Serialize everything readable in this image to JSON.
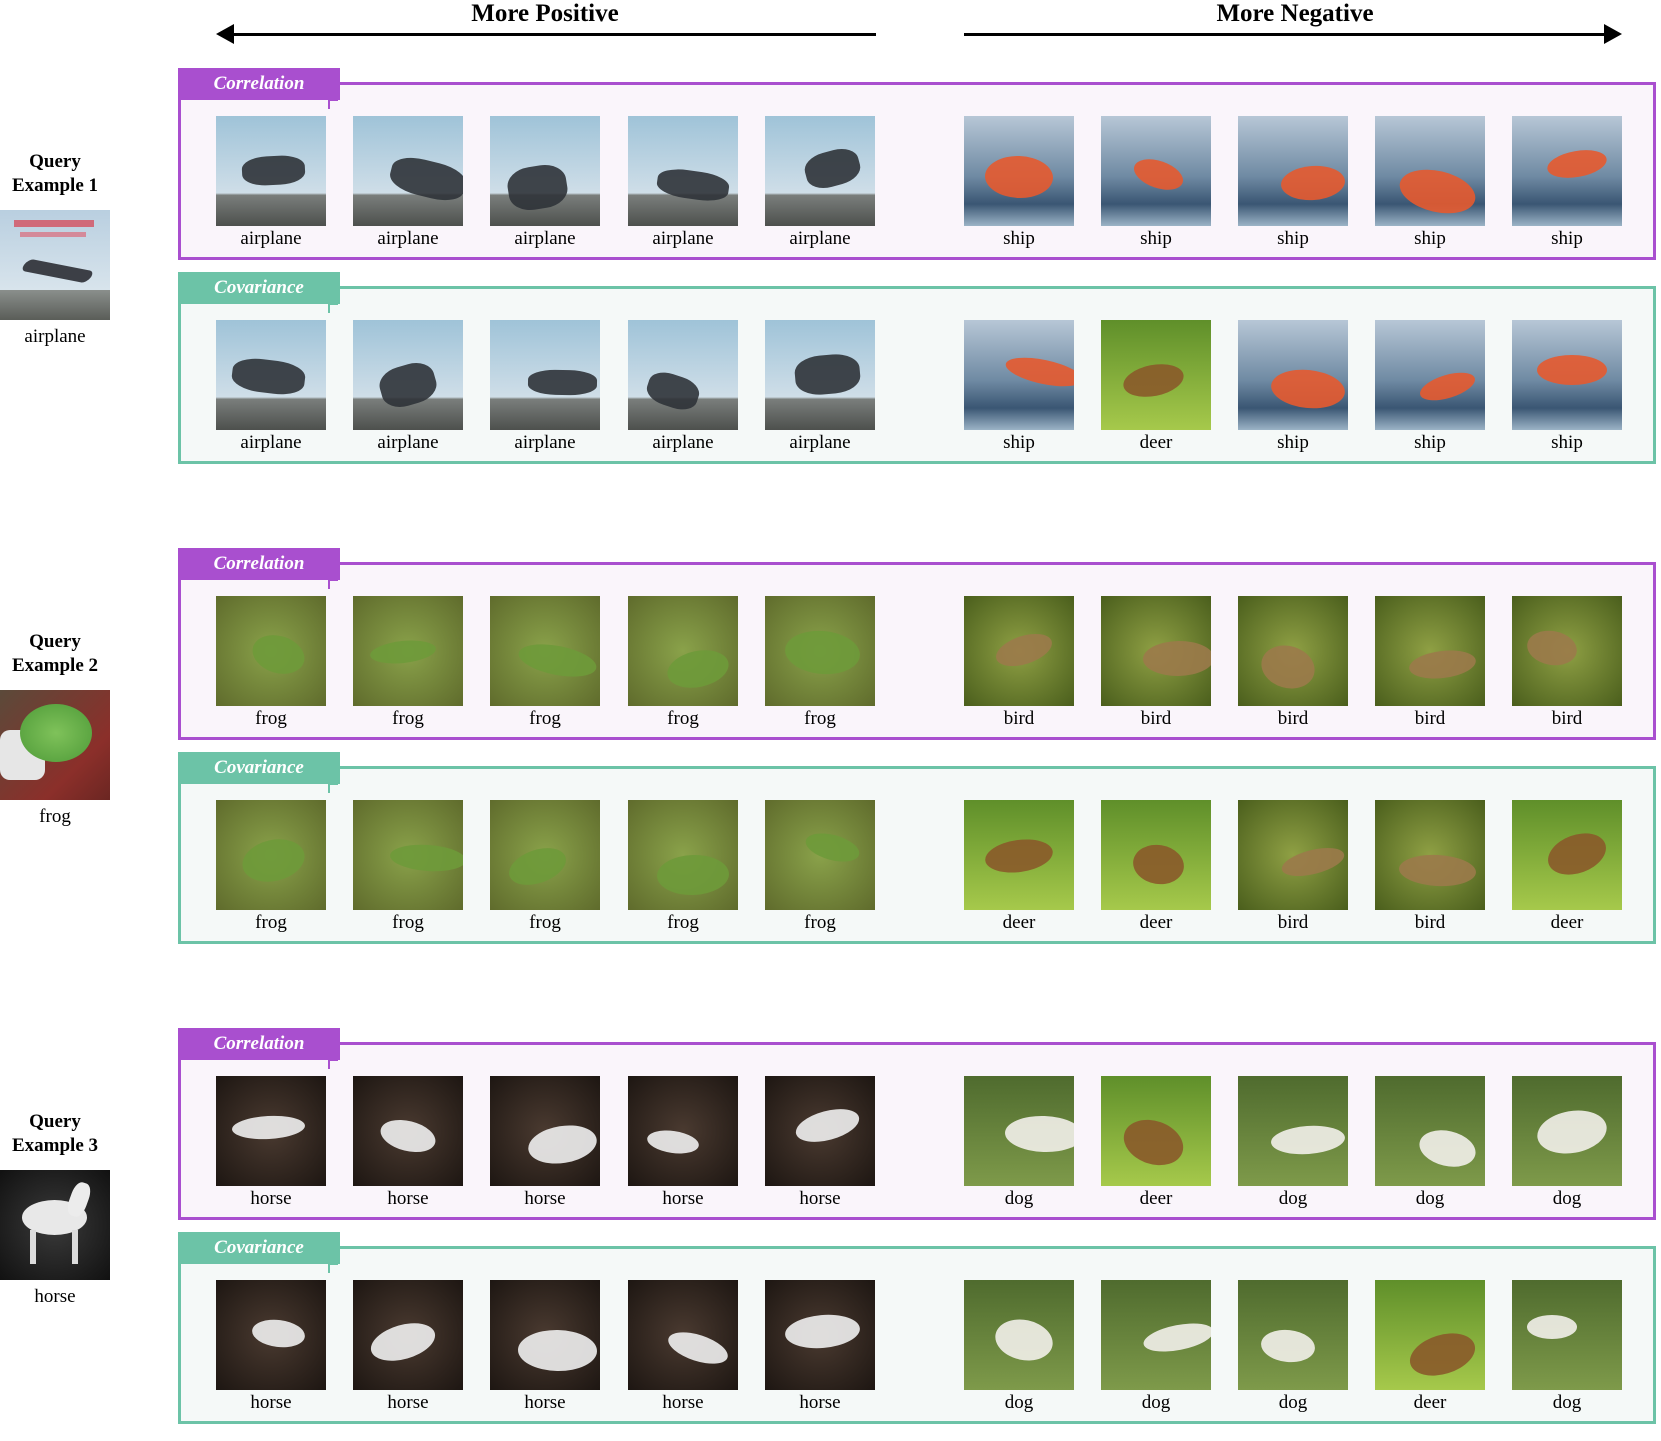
{
  "header": {
    "positive": "More Positive",
    "negative": "More Negative"
  },
  "tabs": {
    "correlation": "Correlation",
    "covariance": "Covariance"
  },
  "colors": {
    "correlation": "#a94fcf",
    "covariance": "#6cc3a7"
  },
  "examples": [
    {
      "title_line1": "Query",
      "title_line2": "Example 1",
      "query_label": "airplane",
      "correlation": [
        "airplane",
        "airplane",
        "airplane",
        "airplane",
        "airplane",
        "ship",
        "ship",
        "ship",
        "ship",
        "ship"
      ],
      "covariance": [
        "airplane",
        "airplane",
        "airplane",
        "airplane",
        "airplane",
        "ship",
        "deer",
        "ship",
        "ship",
        "ship"
      ]
    },
    {
      "title_line1": "Query",
      "title_line2": "Example 2",
      "query_label": "frog",
      "correlation": [
        "frog",
        "frog",
        "frog",
        "frog",
        "frog",
        "bird",
        "bird",
        "bird",
        "bird",
        "bird"
      ],
      "covariance": [
        "frog",
        "frog",
        "frog",
        "frog",
        "frog",
        "deer",
        "deer",
        "bird",
        "bird",
        "deer"
      ]
    },
    {
      "title_line1": "Query",
      "title_line2": "Example 3",
      "query_label": "horse",
      "correlation": [
        "horse",
        "horse",
        "horse",
        "horse",
        "horse",
        "dog",
        "deer",
        "dog",
        "dog",
        "dog"
      ],
      "covariance": [
        "horse",
        "horse",
        "horse",
        "horse",
        "horse",
        "dog",
        "dog",
        "dog",
        "deer",
        "dog"
      ]
    }
  ]
}
